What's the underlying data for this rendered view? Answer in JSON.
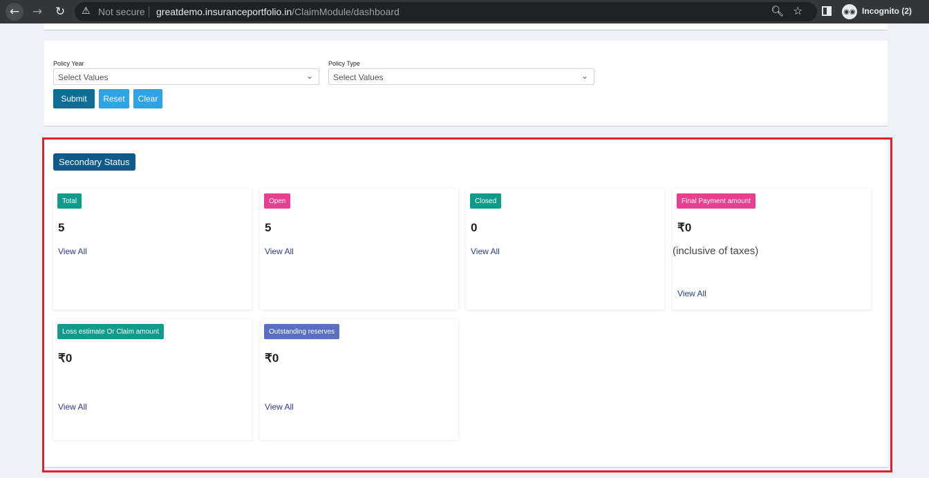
{
  "browser": {
    "warning_icon": "warning-triangle-icon",
    "not_secure": "Not secure",
    "url_host": "greatdemo.insuranceportfolio.in",
    "url_path": "/ClaimModule/dashboard",
    "incognito_label": "Incognito (2)"
  },
  "filters": {
    "policy_year_label": "Policy Year",
    "policy_year_placeholder": "Select Values",
    "policy_type_label": "Policy Type",
    "policy_type_placeholder": "Select Values",
    "submit_label": "Submit",
    "reset_label": "Reset",
    "clear_label": "Clear"
  },
  "section": {
    "title": "Secondary Status"
  },
  "cards": [
    {
      "badge": "Total",
      "value": "5",
      "link": "View All",
      "color": "#129b8a"
    },
    {
      "badge": "Open",
      "value": "5",
      "link": "View All",
      "color": "#e8408e"
    },
    {
      "badge": "Closed",
      "value": "0",
      "link": "View All",
      "color": "#129b8a"
    },
    {
      "badge": "Final Payment amount",
      "value": "₹0",
      "note": "(inclusive of taxes)",
      "link": "View All",
      "color": "#e8408e"
    },
    {
      "badge": "Loss estimate Or Claim amount",
      "value": "₹0",
      "link": "View All",
      "color": "#129b8a"
    },
    {
      "badge": "Outstanding reserves",
      "value": "₹0",
      "link": "View All",
      "color": "#5a6fc0"
    }
  ],
  "colors": {
    "highlight_border": "#e0202a",
    "primary_button": "#0d6d94",
    "secondary_button": "#2ea3e8"
  }
}
